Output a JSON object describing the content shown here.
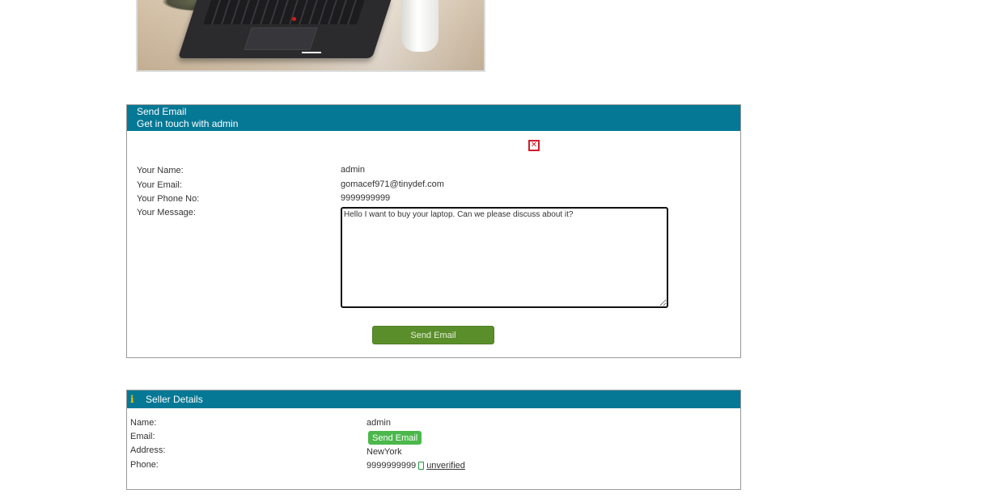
{
  "email_panel": {
    "title": "Send Email",
    "subtitle": "Get in touch with admin",
    "close_icon": "close-icon",
    "fields": {
      "name_label": "Your Name:",
      "name_value": "admin",
      "email_label": "Your Email:",
      "email_value": "gomacef971@tinydef.com",
      "phone_label": "Your Phone No:",
      "phone_value": "9999999999",
      "message_label": "Your Message:",
      "message_value": "Hello I want to buy your laptop. Can we please discuss about it?"
    },
    "send_button": "Send Email"
  },
  "seller_panel": {
    "title": "Seller Details",
    "info_icon": "info-icon",
    "name_label": "Name:",
    "name_value": "admin",
    "email_label": "Email:",
    "email_button": "Send Email",
    "address_label": "Address:",
    "address_value": "NewYork",
    "phone_label": "Phone:",
    "phone_value": "9999999999",
    "phone_icon": "phone-icon",
    "phone_status": "unverified"
  },
  "colors": {
    "header_bg": "#057895",
    "send_button_bg": "#5a8e2a",
    "seller_email_button_bg": "#4cb84c",
    "close_icon": "#d11a2a",
    "info_icon": "#f2c200"
  }
}
